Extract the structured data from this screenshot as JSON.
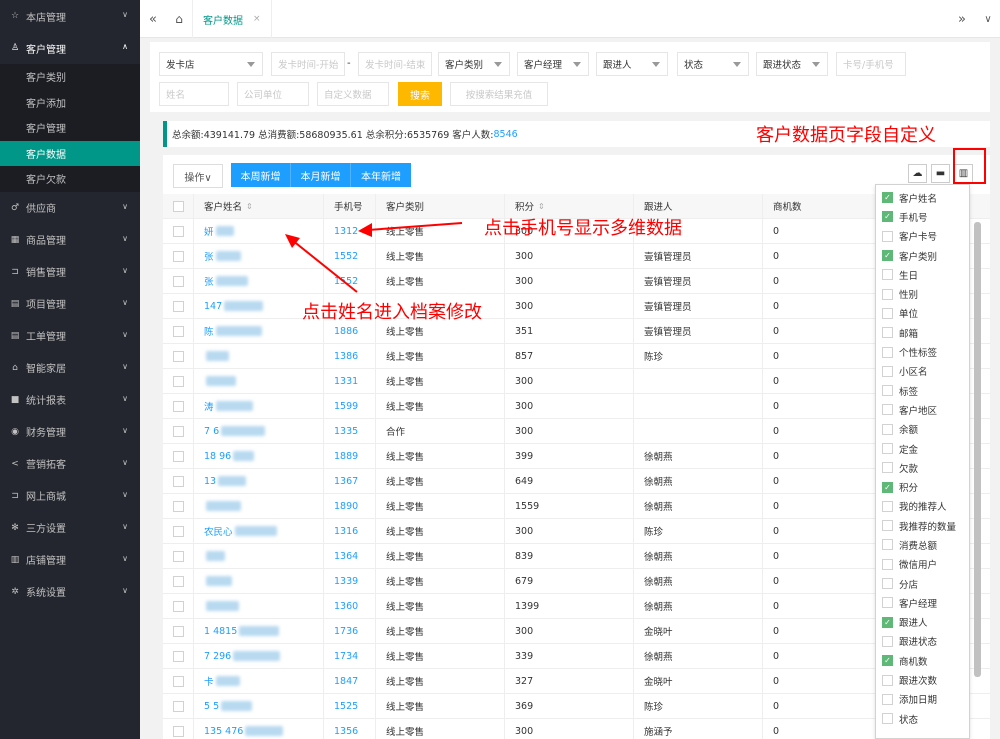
{
  "sidebar": {
    "items": [
      {
        "icon": "star-icon",
        "glyph": "☆",
        "label": "本店管理",
        "open": false
      },
      {
        "icon": "user-icon",
        "glyph": "♙",
        "label": "客户管理",
        "open": true,
        "children": [
          "客户类别",
          "客户添加",
          "客户管理",
          "客户数据",
          "客户欠款"
        ],
        "active_child": 3
      },
      {
        "icon": "male-icon",
        "glyph": "♂",
        "label": "供应商",
        "open": false
      },
      {
        "icon": "grid-icon",
        "glyph": "▦",
        "label": "商品管理",
        "open": false
      },
      {
        "icon": "cart-icon",
        "glyph": "⊐",
        "label": "销售管理",
        "open": false
      },
      {
        "icon": "project-icon",
        "glyph": "▤",
        "label": "项目管理",
        "open": false
      },
      {
        "icon": "order-icon",
        "glyph": "▤",
        "label": "工单管理",
        "open": false
      },
      {
        "icon": "home-icon",
        "glyph": "⌂",
        "label": "智能家居",
        "open": false
      },
      {
        "icon": "report-icon",
        "glyph": "■",
        "label": "统计报表",
        "open": false
      },
      {
        "icon": "finance-icon",
        "glyph": "◉",
        "label": "财务管理",
        "open": false
      },
      {
        "icon": "share-icon",
        "glyph": "<",
        "label": "营销拓客",
        "open": false
      },
      {
        "icon": "mall-icon",
        "glyph": "⊐",
        "label": "网上商城",
        "open": false
      },
      {
        "icon": "gear-icon",
        "glyph": "✻",
        "label": "三方设置",
        "open": false
      },
      {
        "icon": "store-icon",
        "glyph": "▥",
        "label": "店铺管理",
        "open": false
      },
      {
        "icon": "settings-icon",
        "glyph": "✲",
        "label": "系统设置",
        "open": false
      }
    ]
  },
  "topbar": {
    "tab_label": "客户数据",
    "tab_close": "×",
    "left_icon": "«",
    "home_icon": "⌂",
    "right_icon": "»",
    "down_icon": "∨"
  },
  "filters": {
    "store": "发卡店",
    "start_time_ph": "发卡时间-开始",
    "dash": "-",
    "end_time_ph": "发卡时间-结束",
    "category": "客户类别",
    "manager": "客户经理",
    "follower": "跟进人",
    "status": "状态",
    "follow_status": "跟进状态",
    "card_phone_ph": "卡号/手机号",
    "name_ph": "姓名",
    "company_ph": "公司单位",
    "custom_ph": "自定义数据",
    "search_label": "搜索",
    "recharge_label": "按搜索结果充值"
  },
  "summary": {
    "text": "总余额:439141.79 总消费额:58680935.61 总余积分:6535769 客户人数:",
    "count": "8546"
  },
  "toolbar": {
    "op_label": "操作∨",
    "btn_week": "本周新增",
    "btn_month": "本月新增",
    "btn_year": "本年新增"
  },
  "table": {
    "headers": [
      "客户姓名",
      "手机号",
      "客户类别",
      "积分",
      "跟进人",
      "商机数"
    ],
    "sort_glyph": "⇕",
    "rows": [
      {
        "name": "妍",
        "phone": "1312",
        "cat": "线上零售",
        "pts": "300",
        "follower": "",
        "opp": "0"
      },
      {
        "name": "张",
        "phone": "1552",
        "cat": "线上零售",
        "pts": "300",
        "follower": "壹镇管理员",
        "opp": "0"
      },
      {
        "name": "张",
        "phone": "1552",
        "cat": "线上零售",
        "pts": "300",
        "follower": "壹镇管理员",
        "opp": "0"
      },
      {
        "name": "147",
        "phone": "",
        "cat": "",
        "pts": "300",
        "follower": "壹镇管理员",
        "opp": "0"
      },
      {
        "name": "陈",
        "phone": "1886",
        "cat": "线上零售",
        "pts": "351",
        "follower": "壹镇管理员",
        "opp": "0"
      },
      {
        "name": "",
        "phone": "1386",
        "cat": "线上零售",
        "pts": "857",
        "follower": "陈珍",
        "opp": "0"
      },
      {
        "name": "",
        "phone": "1331",
        "cat": "线上零售",
        "pts": "300",
        "follower": "",
        "opp": "0"
      },
      {
        "name": "涛",
        "phone": "1599",
        "cat": "线上零售",
        "pts": "300",
        "follower": "",
        "opp": "0"
      },
      {
        "name": "7 6",
        "phone": "1335",
        "cat": "合作",
        "pts": "300",
        "follower": "",
        "opp": "0"
      },
      {
        "name": "18 96",
        "phone": "1889",
        "cat": "线上零售",
        "pts": "399",
        "follower": "徐朝燕",
        "opp": "0"
      },
      {
        "name": "13",
        "phone": "1367",
        "cat": "线上零售",
        "pts": "649",
        "follower": "徐朝燕",
        "opp": "0"
      },
      {
        "name": "",
        "phone": "1890",
        "cat": "线上零售",
        "pts": "1559",
        "follower": "徐朝燕",
        "opp": "0"
      },
      {
        "name": "农民心",
        "phone": "1316",
        "cat": "线上零售",
        "pts": "300",
        "follower": "陈珍",
        "opp": "0"
      },
      {
        "name": "",
        "phone": "1364",
        "cat": "线上零售",
        "pts": "839",
        "follower": "徐朝燕",
        "opp": "0"
      },
      {
        "name": "",
        "phone": "1339",
        "cat": "线上零售",
        "pts": "679",
        "follower": "徐朝燕",
        "opp": "0"
      },
      {
        "name": "",
        "phone": "1360",
        "cat": "线上零售",
        "pts": "1399",
        "follower": "徐朝燕",
        "opp": "0"
      },
      {
        "name": "1 4815",
        "phone": "1736",
        "cat": "线上零售",
        "pts": "300",
        "follower": "金晓叶",
        "opp": "0"
      },
      {
        "name": "7 296",
        "phone": "1734",
        "cat": "线上零售",
        "pts": "339",
        "follower": "徐朝燕",
        "opp": "0"
      },
      {
        "name": "卡",
        "phone": "1847",
        "cat": "线上零售",
        "pts": "327",
        "follower": "金晓叶",
        "opp": "0"
      },
      {
        "name": "5 5",
        "phone": "1525",
        "cat": "线上零售",
        "pts": "369",
        "follower": "陈珍",
        "opp": "0"
      },
      {
        "name": "135 476",
        "phone": "1356",
        "cat": "线上零售",
        "pts": "300",
        "follower": "施涵予",
        "opp": "0"
      }
    ]
  },
  "columns_panel": {
    "items": [
      {
        "label": "客户姓名",
        "checked": true
      },
      {
        "label": "手机号",
        "checked": true
      },
      {
        "label": "客户卡号",
        "checked": false
      },
      {
        "label": "客户类别",
        "checked": true
      },
      {
        "label": "生日",
        "checked": false
      },
      {
        "label": "性别",
        "checked": false
      },
      {
        "label": "单位",
        "checked": false
      },
      {
        "label": "邮箱",
        "checked": false
      },
      {
        "label": "个性标签",
        "checked": false
      },
      {
        "label": "小区名",
        "checked": false
      },
      {
        "label": "标签",
        "checked": false
      },
      {
        "label": "客户地区",
        "checked": false
      },
      {
        "label": "余额",
        "checked": false
      },
      {
        "label": "定金",
        "checked": false
      },
      {
        "label": "欠款",
        "checked": false
      },
      {
        "label": "积分",
        "checked": true
      },
      {
        "label": "我的推荐人",
        "checked": false
      },
      {
        "label": "我推荐的数量",
        "checked": false
      },
      {
        "label": "消费总额",
        "checked": false
      },
      {
        "label": "微信用户",
        "checked": false
      },
      {
        "label": "分店",
        "checked": false
      },
      {
        "label": "客户经理",
        "checked": false
      },
      {
        "label": "跟进人",
        "checked": true
      },
      {
        "label": "跟进状态",
        "checked": false
      },
      {
        "label": "商机数",
        "checked": true
      },
      {
        "label": "跟进次数",
        "checked": false
      },
      {
        "label": "添加日期",
        "checked": false
      },
      {
        "label": "状态",
        "checked": false
      }
    ]
  },
  "annotations": {
    "custom_fields": "客户数据页字段自定义",
    "phone_hint": "点击手机号显示多维数据",
    "name_hint": "点击姓名进入档案修改"
  },
  "colors": {
    "accent": "#009688",
    "blue": "#1e9fff",
    "yellow": "#ffb800",
    "red": "#ff0000",
    "check": "#5fb878"
  }
}
